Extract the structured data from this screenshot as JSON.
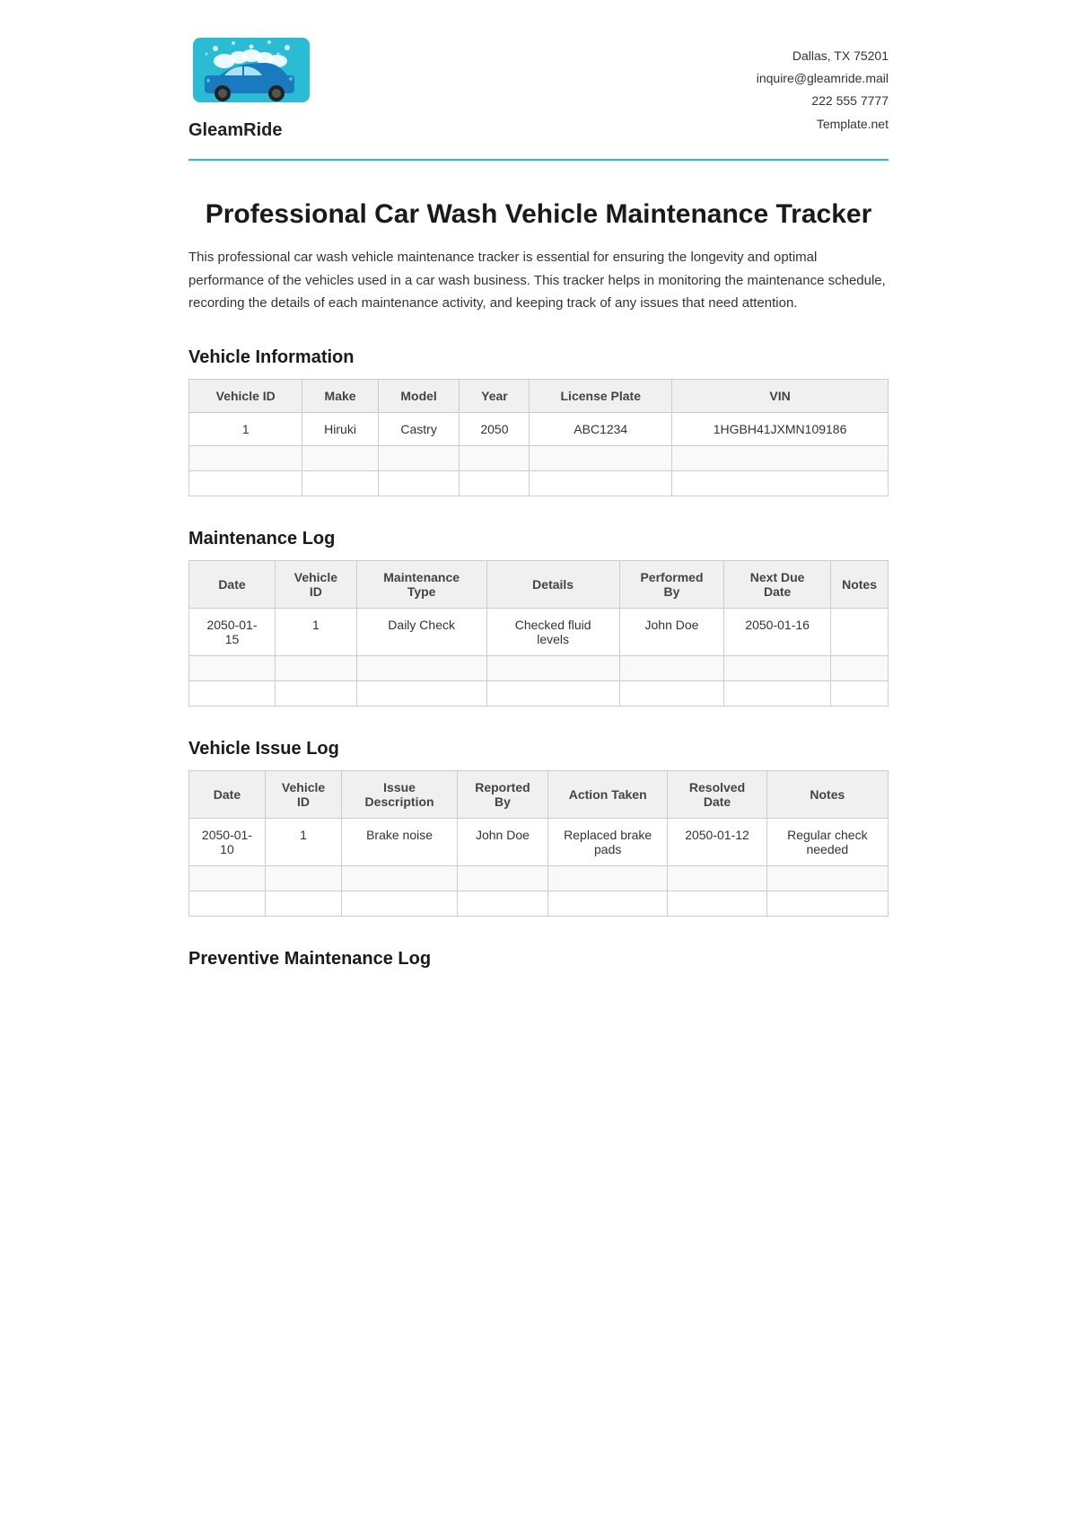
{
  "company": {
    "name": "GleamRide",
    "address": "Dallas, TX 75201",
    "email": "inquire@gleamride.mail",
    "phone": "222 555 7777",
    "website": "Template.net"
  },
  "document": {
    "title": "Professional Car Wash Vehicle Maintenance Tracker",
    "description": "This professional car wash vehicle maintenance tracker is essential for ensuring the longevity and optimal performance of the vehicles used in a car wash business. This tracker helps in monitoring the maintenance schedule, recording the details of each maintenance activity, and keeping track of any issues that need attention."
  },
  "vehicle_information": {
    "section_title": "Vehicle Information",
    "columns": [
      "Vehicle ID",
      "Make",
      "Model",
      "Year",
      "License Plate",
      "VIN"
    ],
    "rows": [
      [
        "1",
        "Hiruki",
        "Castry",
        "2050",
        "ABC1234",
        "1HGBH41JXMN109186"
      ],
      [
        "",
        "",
        "",
        "",
        "",
        ""
      ],
      [
        "",
        "",
        "",
        "",
        "",
        ""
      ]
    ]
  },
  "maintenance_log": {
    "section_title": "Maintenance Log",
    "columns": [
      "Date",
      "Vehicle ID",
      "Maintenance Type",
      "Details",
      "Performed By",
      "Next Due Date",
      "Notes"
    ],
    "rows": [
      [
        "2050-01-15",
        "1",
        "Daily Check",
        "Checked fluid levels",
        "John Doe",
        "2050-01-16",
        ""
      ],
      [
        "",
        "",
        "",
        "",
        "",
        "",
        ""
      ],
      [
        "",
        "",
        "",
        "",
        "",
        "",
        ""
      ]
    ]
  },
  "vehicle_issue_log": {
    "section_title": "Vehicle Issue Log",
    "columns": [
      "Date",
      "Vehicle ID",
      "Issue Description",
      "Reported By",
      "Action Taken",
      "Resolved Date",
      "Notes"
    ],
    "rows": [
      [
        "2050-01-10",
        "1",
        "Brake noise",
        "John Doe",
        "Replaced brake pads",
        "2050-01-12",
        "Regular check needed"
      ],
      [
        "",
        "",
        "",
        "",
        "",
        "",
        ""
      ],
      [
        "",
        "",
        "",
        "",
        "",
        "",
        ""
      ]
    ]
  },
  "preventive_maintenance": {
    "section_title": "Preventive Maintenance Log"
  }
}
